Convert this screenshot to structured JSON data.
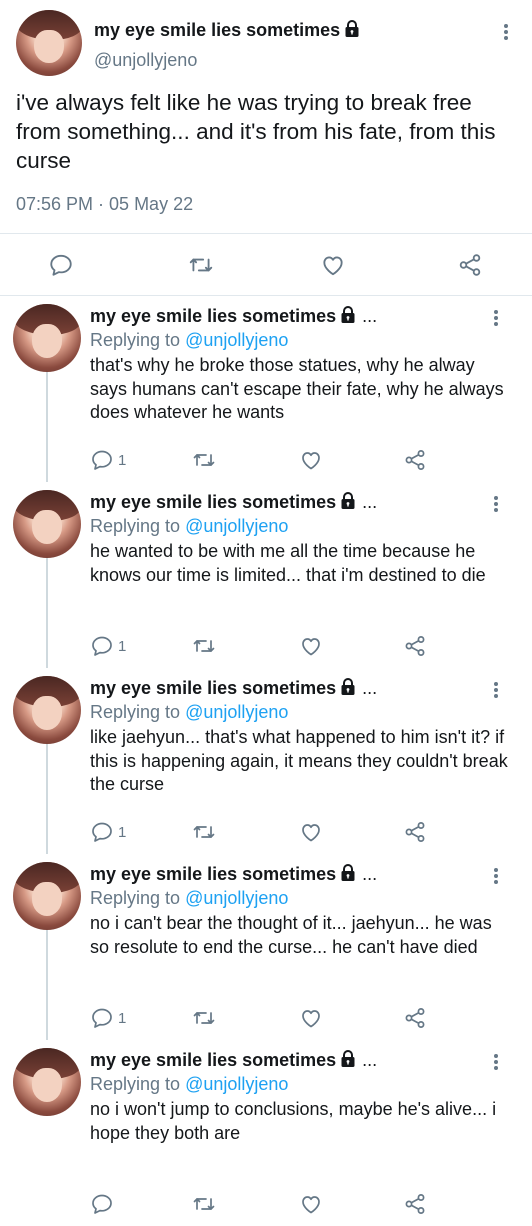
{
  "main_tweet": {
    "display_name": "my eye smile lies sometimes",
    "handle": "@unjollyjeno",
    "text": "i've always felt like he was trying to break free from something... and it's from his fate, from this curse",
    "timestamp": "07:56 PM · 05 May 22"
  },
  "replies": [
    {
      "display_name": "my eye smile lies sometimes",
      "ellipsis": "...",
      "replying_prefix": "Replying to",
      "replying_to": "@unjollyjeno",
      "text": "that's why he broke those statues, why he alway says humans can't escape their fate, why he always does whatever he wants",
      "reply_count": "1"
    },
    {
      "display_name": "my eye smile lies sometimes",
      "ellipsis": "...",
      "replying_prefix": "Replying to",
      "replying_to": "@unjollyjeno",
      "text": "he wanted to be with me all the time because he knows our time is limited... that i'm destined to die",
      "reply_count": "1"
    },
    {
      "display_name": "my eye smile lies sometimes",
      "ellipsis": "...",
      "replying_prefix": "Replying to",
      "replying_to": "@unjollyjeno",
      "text": "like jaehyun... that's what happened to him isn't it? if this is happening again, it means they couldn't break the curse",
      "reply_count": "1"
    },
    {
      "display_name": "my eye smile lies sometimes",
      "ellipsis": "...",
      "replying_prefix": "Replying to",
      "replying_to": "@unjollyjeno",
      "text": "no i can't bear the thought of it... jaehyun... he was so resolute to end the curse... he can't have died",
      "reply_count": "1"
    },
    {
      "display_name": "my eye smile lies sometimes",
      "ellipsis": "...",
      "replying_prefix": "Replying to",
      "replying_to": "@unjollyjeno",
      "text": "no i won't jump to conclusions, maybe he's alive... i hope they both are",
      "reply_count": ""
    }
  ],
  "icons": {
    "reply": "reply-icon",
    "retweet": "retweet-icon",
    "like": "heart-icon",
    "share": "share-icon",
    "more": "kebab-icon",
    "lock": "lock-icon"
  },
  "colors": {
    "text": "#14171a",
    "muted": "#657786",
    "link": "#1da1f2",
    "divider": "#e1e8ed"
  }
}
